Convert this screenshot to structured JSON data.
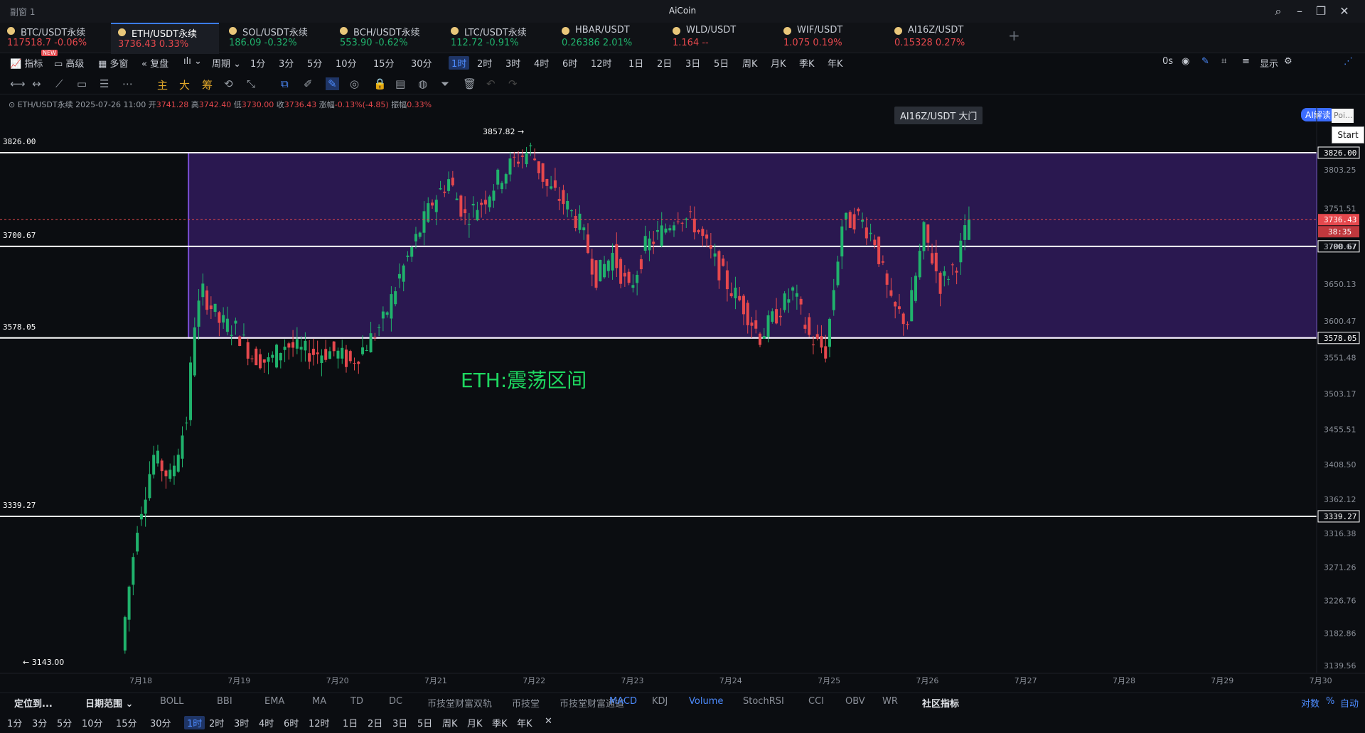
{
  "window": {
    "left_title": "副窗 1",
    "app_title": "AiCoin"
  },
  "tabs": [
    {
      "name": "BTC/USDT永续",
      "price": "117518.7",
      "change": "-0.06%",
      "dir": "down"
    },
    {
      "name": "ETH/USDT永续",
      "price": "3736.43",
      "change": "0.33%",
      "dir": "down",
      "active": true
    },
    {
      "name": "SOL/USDT永续",
      "price": "186.09",
      "change": "-0.32%",
      "dir": "up"
    },
    {
      "name": "BCH/USDT永续",
      "price": "553.90",
      "change": "-0.62%",
      "dir": "up"
    },
    {
      "name": "LTC/USDT永续",
      "price": "112.72",
      "change": "-0.91%",
      "dir": "up"
    },
    {
      "name": "HBAR/USDT",
      "price": "0.26386",
      "change": "2.01%",
      "dir": "up"
    },
    {
      "name": "WLD/USDT",
      "price": "1.164",
      "change": "--",
      "dir": "down"
    },
    {
      "name": "WIF/USDT",
      "price": "1.075",
      "change": "0.19%",
      "dir": "down"
    },
    {
      "name": "AI16Z/USDT",
      "price": "0.15328",
      "change": "0.27%",
      "dir": "down"
    }
  ],
  "toolbar": {
    "indicator": "指标",
    "advanced": "高级",
    "new_badge": "NEW",
    "multi": "多窗",
    "replay": "复盘",
    "period": "周期",
    "intervals": [
      "1分",
      "3分",
      "5分",
      "10分",
      "15分",
      "30分",
      "1时",
      "2时",
      "3时",
      "4时",
      "6时",
      "12时",
      "1日",
      "2日",
      "3日",
      "5日",
      "周K",
      "月K",
      "季K",
      "年K"
    ],
    "selected_interval": "1时",
    "tooltip": "AI16Z/USDT 大门",
    "countdown": "0s",
    "display": "显示",
    "ai_read": "AI解读"
  },
  "drawtools": {
    "main": "主",
    "big": "大",
    "chip": "筹"
  },
  "infobar": {
    "symbol": "ETH/USDT永续",
    "datetime": "2025-07-26 11:00",
    "open_label": "开",
    "open": "3741.28",
    "high_label": "高",
    "high": "3742.40",
    "low_label": "低",
    "low": "3730.00",
    "close_label": "收",
    "close": "3736.43",
    "change_label": "涨幅",
    "change": "-0.13%(-4.85)",
    "amp_label": "振幅",
    "amp": "0.33%"
  },
  "chart_data": {
    "type": "candlestick",
    "symbol": "ETH/USDT永续",
    "interval": "1时",
    "ylim": [
      3139.56,
      3857.82
    ],
    "y_ticks": [
      "3803.25",
      "3751.51",
      "3700.67",
      "3650.13",
      "3600.47",
      "3551.48",
      "3503.17",
      "3455.51",
      "3408.50",
      "3362.12",
      "3316.38",
      "3271.26",
      "3226.76",
      "3182.86",
      "3139.56"
    ],
    "x_ticks": [
      "7月18",
      "7月19",
      "7月20",
      "7月21",
      "7月22",
      "7月23",
      "7月24",
      "7月25",
      "7月26",
      "7月27",
      "7月28",
      "7月29",
      "7月30"
    ],
    "horizontal_levels": [
      {
        "value": 3826.0,
        "label": "3826.00",
        "color": "#ffffff"
      },
      {
        "value": 3700.67,
        "label": "3700.67",
        "color": "#ffffff"
      },
      {
        "value": 3578.05,
        "label": "3578.05",
        "color": "#ffffff"
      },
      {
        "value": 3339.27,
        "label": "3339.27",
        "color": "#ffffff"
      }
    ],
    "range_box": {
      "top": 3826.0,
      "bottom": 3578.05,
      "start": "7月18 12:00",
      "fill": "#2a1850",
      "border": "#7a4fd6"
    },
    "annotation": "ETH:震荡区间",
    "high_marker": "3857.82",
    "low_marker": "3143.00",
    "last_price": "3736.43",
    "countdown": "38:35",
    "close_path": [
      {
        "t": "7月17 20:00",
        "c": 3160
      },
      {
        "t": "7月18 00:00",
        "c": 3330
      },
      {
        "t": "7月18 04:00",
        "c": 3420
      },
      {
        "t": "7月18 08:00",
        "c": 3390
      },
      {
        "t": "7月18 12:00",
        "c": 3470
      },
      {
        "t": "7月18 14:00",
        "c": 3600
      },
      {
        "t": "7月18 16:00",
        "c": 3640
      },
      {
        "t": "7月18 20:00",
        "c": 3600
      },
      {
        "t": "7月19 00:00",
        "c": 3590
      },
      {
        "t": "7月19 04:00",
        "c": 3555
      },
      {
        "t": "7月19 08:00",
        "c": 3545
      },
      {
        "t": "7month19 12:00",
        "c": 3570
      },
      {
        "t": "7月19 16:00",
        "c": 3560
      },
      {
        "t": "7月19 20:00",
        "c": 3558
      },
      {
        "t": "7月20 00:00",
        "c": 3560
      },
      {
        "t": "7月20 04:00",
        "c": 3545
      },
      {
        "t": "7月20 08:00",
        "c": 3570
      },
      {
        "t": "7月20 12:00",
        "c": 3600
      },
      {
        "t": "7月20 16:00",
        "c": 3660
      },
      {
        "t": "7月20 20:00",
        "c": 3710
      },
      {
        "t": "7月21 00:00",
        "c": 3760
      },
      {
        "t": "7月21 04:00",
        "c": 3790
      },
      {
        "t": "7月21 08:00",
        "c": 3740
      },
      {
        "t": "7月21 12:00",
        "c": 3760
      },
      {
        "t": "7月21 16:00",
        "c": 3790
      },
      {
        "t": "7月21 20:00",
        "c": 3815
      },
      {
        "t": "7月22 00:00",
        "c": 3830
      },
      {
        "t": "7月22 04:00",
        "c": 3780
      },
      {
        "t": "7月22 08:00",
        "c": 3760
      },
      {
        "t": "7月22 12:00",
        "c": 3730
      },
      {
        "t": "7月22 16:00",
        "c": 3660
      },
      {
        "t": "7月22 20:00",
        "c": 3690
      },
      {
        "t": "7月23 00:00",
        "c": 3640
      },
      {
        "t": "7月23 04:00",
        "c": 3700
      },
      {
        "t": "7月23 08:00",
        "c": 3720
      },
      {
        "t": "7月23 12:00",
        "c": 3745
      },
      {
        "t": "7月23 16:00",
        "c": 3730
      },
      {
        "t": "7月23 20:00",
        "c": 3690
      },
      {
        "t": "7月24 00:00",
        "c": 3650
      },
      {
        "t": "7月24 04:00",
        "c": 3620
      },
      {
        "t": "7月24 08:00",
        "c": 3580
      },
      {
        "t": "7月24 12:00",
        "c": 3610
      },
      {
        "t": "7月24 16:00",
        "c": 3640
      },
      {
        "t": "7月24 20:00",
        "c": 3580
      },
      {
        "t": "7月25 00:00",
        "c": 3560
      },
      {
        "t": "7月25 04:00",
        "c": 3730
      },
      {
        "t": "7月25 08:00",
        "c": 3740
      },
      {
        "t": "7月25 12:00",
        "c": 3710
      },
      {
        "t": "7月25 16:00",
        "c": 3620
      },
      {
        "t": "7月25 20:00",
        "c": 3600
      },
      {
        "t": "7月26 00:00",
        "c": 3720
      },
      {
        "t": "7月26 04:00",
        "c": 3650
      },
      {
        "t": "7月26 08:00",
        "c": 3680
      },
      {
        "t": "7月26 11:00",
        "c": 3736
      }
    ]
  },
  "bottom": {
    "locate": "定位到...",
    "date_range": "日期范围",
    "main_inds": [
      "BOLL",
      "BBI",
      "EMA",
      "MA",
      "TD",
      "DC",
      "币技堂财富双轨",
      "币技堂",
      "币技堂财富通道"
    ],
    "sub_inds": [
      "MACD",
      "KDJ",
      "Volume",
      "StochRSI",
      "CCI",
      "OBV",
      "WR"
    ],
    "community": "社区指标",
    "right": [
      "对数",
      "%",
      "自动"
    ],
    "intervals": [
      "1分",
      "3分",
      "5分",
      "10分",
      "15分",
      "30分",
      "1时",
      "2时",
      "3时",
      "4时",
      "6时",
      "12时",
      "1日",
      "2日",
      "3日",
      "5日",
      "周K",
      "月K",
      "季K",
      "年K"
    ],
    "selected_interval": "1时"
  },
  "side_widget": {
    "poi": "Poi...",
    "start": "Start"
  },
  "colors": {
    "up": "#20b26c",
    "down": "#e5484d",
    "accent": "#3b7cff",
    "box": "#2a1850",
    "box_border": "#7a4fd6",
    "annotation": "#1ed760"
  }
}
